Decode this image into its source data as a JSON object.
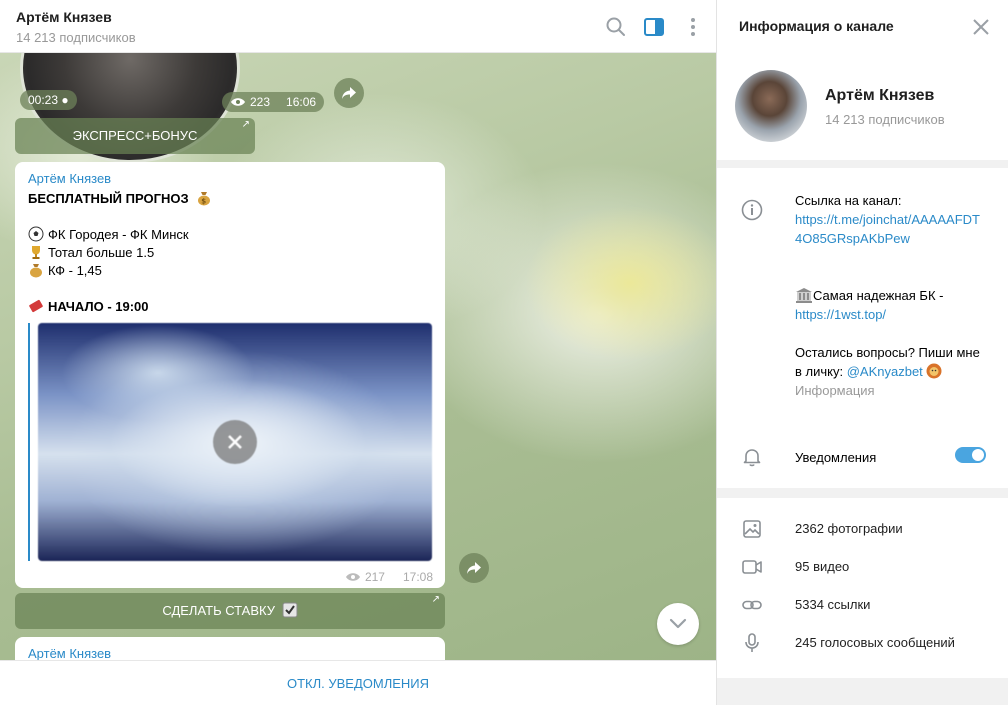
{
  "chat": {
    "title": "Артём Князев",
    "subtitle": "14 213 подписчиков",
    "video": {
      "duration": "00:23",
      "views": "223",
      "time": "16:06"
    },
    "express_button": "ЭКСПРЕСС+БОНУС",
    "post": {
      "author": "Артём Князев",
      "headline": "БЕСПЛАТНЫЙ ПРОГНОЗ",
      "match": "ФК Городея - ФК Минск",
      "total": "Тотал больше 1.5",
      "odds": "КФ - 1,45",
      "start": "НАЧАЛО - 19:00",
      "views": "217",
      "time": "17:08"
    },
    "bet_button": "СДЕЛАТЬ СТАВКУ",
    "next_post_author": "Артём Князев",
    "mute_button": "ОТКЛ. УВЕДОМЛЕНИЯ"
  },
  "info": {
    "title": "Информация о канале",
    "channel_name": "Артём Князев",
    "subscribers": "14 213 подписчиков",
    "desc": {
      "link_label": "Ссылка на канал:",
      "link_url": "https://t.me/joinchat/AAAAAFDT4O85GRspAKbPew",
      "bk_text": "Самая надежная БК -",
      "bk_url": "https://1wst.top/",
      "questions": "Остались вопросы? Пиши мне в личку:",
      "contact": "@AKnyazbet",
      "info_label": "Информация"
    },
    "notifications_label": "Уведомления",
    "notifications_on": true,
    "media": {
      "photos": "2362 фотографии",
      "videos": "95 видео",
      "links": "5334 ссылки",
      "voice": "245 голосовых сообщений"
    }
  },
  "colors": {
    "accent": "#2a8ac8",
    "toggle": "#4aa5e0"
  }
}
